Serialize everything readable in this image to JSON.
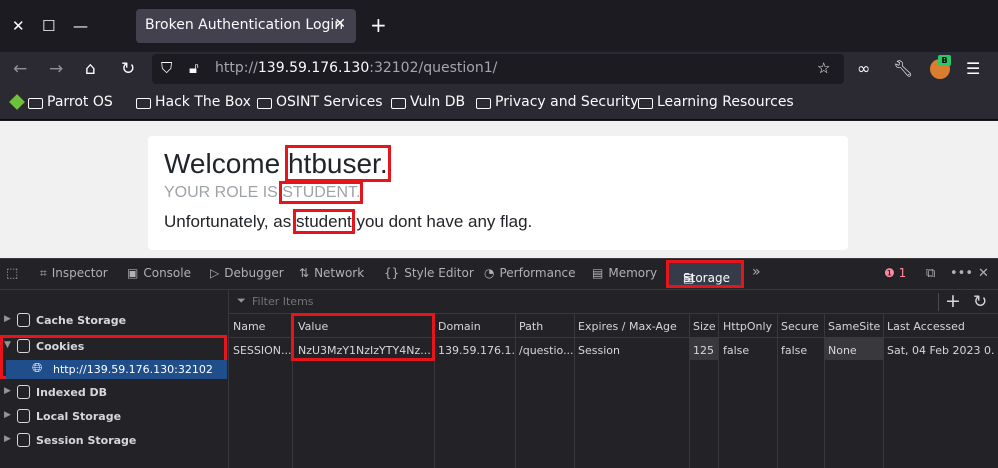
{
  "browser": {
    "tab_title": "Broken Authentication Login",
    "url": {
      "scheme": "http://",
      "host": "139.59.176.130",
      "rest": ":32102/question1/"
    },
    "extension_badge": "B",
    "bookmarks": [
      "Parrot OS",
      "Hack The Box",
      "OSINT Services",
      "Vuln DB",
      "Privacy and Security",
      "Learning Resources"
    ]
  },
  "page": {
    "welcome_prefix": "Welcome ",
    "username": "htbuser.",
    "role_prefix": "YOUR ROLE IS ",
    "role_value": "STUDENT.",
    "flag_prefix": "Unfortunately, as ",
    "flag_role": "student",
    "flag_suffix": " you dont have any flag."
  },
  "devtools": {
    "tabs": [
      "Inspector",
      "Console",
      "Debugger",
      "Network",
      "Style Editor",
      "Performance",
      "Memory",
      "Storage"
    ],
    "active_tab": "Storage",
    "error_count": "1",
    "sidebar": {
      "cache_storage": "Cache Storage",
      "cookies": "Cookies",
      "cookie_host": "http://139.59.176.130:32102",
      "indexed_db": "Indexed DB",
      "local_storage": "Local Storage",
      "session_storage": "Session Storage"
    },
    "filter_placeholder": "Filter Items",
    "columns": [
      "Name",
      "Value",
      "Domain",
      "Path",
      "Expires / Max-Age",
      "Size",
      "HttpOnly",
      "Secure",
      "SameSite",
      "Last Accessed"
    ],
    "rows": [
      [
        "SESSION...",
        "NzU3MzY1NzIzYTY4Nz...",
        "139.59.176.1...",
        "/questio...",
        "Session",
        "125",
        "false",
        "false",
        "None",
        "Sat, 04 Feb 2023 0..."
      ]
    ]
  },
  "colors": {
    "highlight_red": "#e6151c",
    "selection_blue": "#204e8a",
    "devtools_bg": "#232327",
    "page_bg": "#f1f1f1"
  }
}
